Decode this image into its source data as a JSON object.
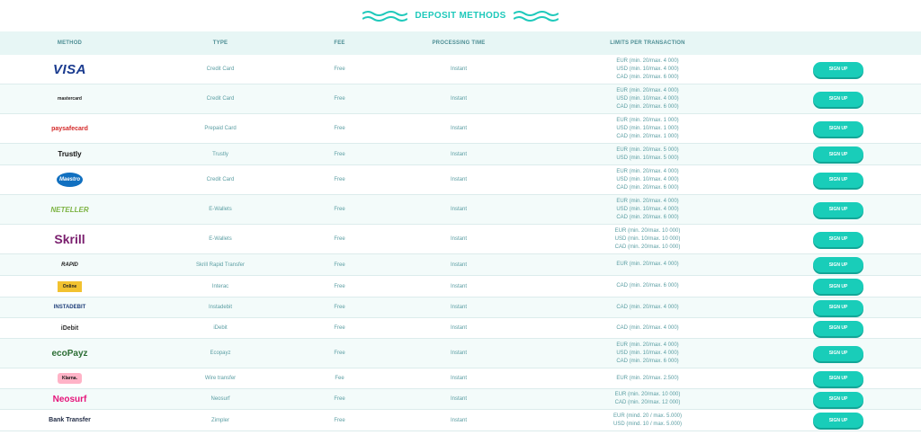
{
  "header": {
    "title": "DEPOSIT METHODS"
  },
  "columns": {
    "method": "METHOD",
    "type": "TYPE",
    "fee": "FEE",
    "processing": "PROCESSING TIME",
    "limits": "LIMITS PER TRANSACTION"
  },
  "rows": [
    {
      "logo": "VISA",
      "logo_icon": "visa-logo-icon",
      "type": "Credit Card",
      "fee": "Free",
      "processing": "Instant",
      "limits": [
        "EUR (min. 20/max. 4 000)",
        "USD (min. 10/max. 4 000)",
        "CAD (min. 20/max. 6 000)"
      ],
      "button": "SIGN UP"
    },
    {
      "logo": "mastercard",
      "logo_icon": "mastercard-logo-icon",
      "type": "Credit Card",
      "fee": "Free",
      "processing": "Instant",
      "limits": [
        "EUR (min. 20/max. 4 000)",
        "USD (min. 10/max. 4 000)",
        "CAD (min. 20/max. 6 000)"
      ],
      "button": "SIGN UP"
    },
    {
      "logo": "paysafecard",
      "logo_icon": "paysafecard-logo-icon",
      "type": "Prepaid Card",
      "fee": "Free",
      "processing": "Instant",
      "limits": [
        "EUR (min. 20/max. 1 000)",
        "USD (min. 10/max. 1 000)",
        "CAD (min. 20/max. 1 000)"
      ],
      "button": "SIGN UP"
    },
    {
      "logo": "Trustly",
      "logo_icon": "trustly-logo-icon",
      "type": "Trustly",
      "fee": "Free",
      "processing": "Instant",
      "limits": [
        "EUR (min. 20/max. 5 000)",
        "USD (min. 10/max. 5 000)"
      ],
      "button": "SIGN UP"
    },
    {
      "logo": "Maestro",
      "logo_icon": "maestro-logo-icon",
      "type": "Credit Card",
      "fee": "Free",
      "processing": "Instant",
      "limits": [
        "EUR (min. 20/max. 4 000)",
        "USD (min. 10/max. 4 000)",
        "CAD (min. 20/max. 6 000)"
      ],
      "button": "SIGN UP"
    },
    {
      "logo": "NETELLER",
      "logo_icon": "neteller-logo-icon",
      "type": "E-Wallets",
      "fee": "Free",
      "processing": "Instant",
      "limits": [
        "EUR (min. 20/max. 4 000)",
        "USD (min. 10/max. 4 000)",
        "CAD (min. 20/max. 6 000)"
      ],
      "button": "SIGN UP"
    },
    {
      "logo": "Skrill",
      "logo_icon": "skrill-logo-icon",
      "type": "E-Wallets",
      "fee": "Free",
      "processing": "Instant",
      "limits": [
        "EUR (min. 20/max. 10 000)",
        "USD (min. 10/max. 10 000)",
        "CAD (min. 20/max. 10 000)"
      ],
      "button": "SIGN UP"
    },
    {
      "logo": "RAPID",
      "logo_icon": "skrill-rapid-logo-icon",
      "type": "Skrill Rapid Transfer",
      "fee": "Free",
      "processing": "Instant",
      "limits": [
        "EUR (min. 20/max. 4 000)"
      ],
      "button": "SIGN UP"
    },
    {
      "logo": "Online",
      "logo_icon": "interac-logo-icon",
      "type": "Interac",
      "fee": "Free",
      "processing": "Instant",
      "limits": [
        "CAD (min. 20/max. 6 000)"
      ],
      "button": "SIGN UP"
    },
    {
      "logo": "INSTADEBIT",
      "logo_icon": "instadebit-logo-icon",
      "type": "Instadebit",
      "fee": "Free",
      "processing": "Instant",
      "limits": [
        "CAD (min. 20/max. 4 000)"
      ],
      "button": "SIGN UP"
    },
    {
      "logo": "iDebit",
      "logo_icon": "idebit-logo-icon",
      "type": "iDebit",
      "fee": "Free",
      "processing": "Instant",
      "limits": [
        "CAD (min. 20/max. 4 000)"
      ],
      "button": "SIGN UP"
    },
    {
      "logo": "ecoPayz",
      "logo_icon": "ecopayz-logo-icon",
      "type": "Ecopayz",
      "fee": "Free",
      "processing": "Instant",
      "limits": [
        "EUR (min. 20/max. 4 000)",
        "USD (min. 10/max. 4 000)",
        "CAD (min. 20/max. 6 000)"
      ],
      "button": "SIGN UP"
    },
    {
      "logo": "Klarna.",
      "logo_icon": "klarna-logo-icon",
      "type": "Wire transfer",
      "fee": "Fee",
      "processing": "Instant",
      "limits": [
        "EUR (min. 20/max. 2.500)"
      ],
      "button": "SIGN UP"
    },
    {
      "logo": "Neosurf",
      "logo_icon": "neosurf-logo-icon",
      "type": "Neosurf",
      "fee": "Free",
      "processing": "Instant",
      "limits": [
        "EUR (min. 20/max. 10 000)",
        "CAD (min. 20/max. 12 000)"
      ],
      "button": "SIGN UP"
    },
    {
      "logo": "Bank Transfer",
      "logo_icon": "bank-transfer-logo-icon",
      "type": "Zimpler",
      "fee": "Free",
      "processing": "Instant",
      "limits": [
        "EUR (mind. 20 / max. 5.000)",
        "USD (mind. 10 / max. 5.000)"
      ],
      "button": "SIGN UP"
    }
  ],
  "colors": {
    "accent": "#19cdb9",
    "header_bg": "#e7f6f5",
    "text": "#5b9ea3"
  }
}
